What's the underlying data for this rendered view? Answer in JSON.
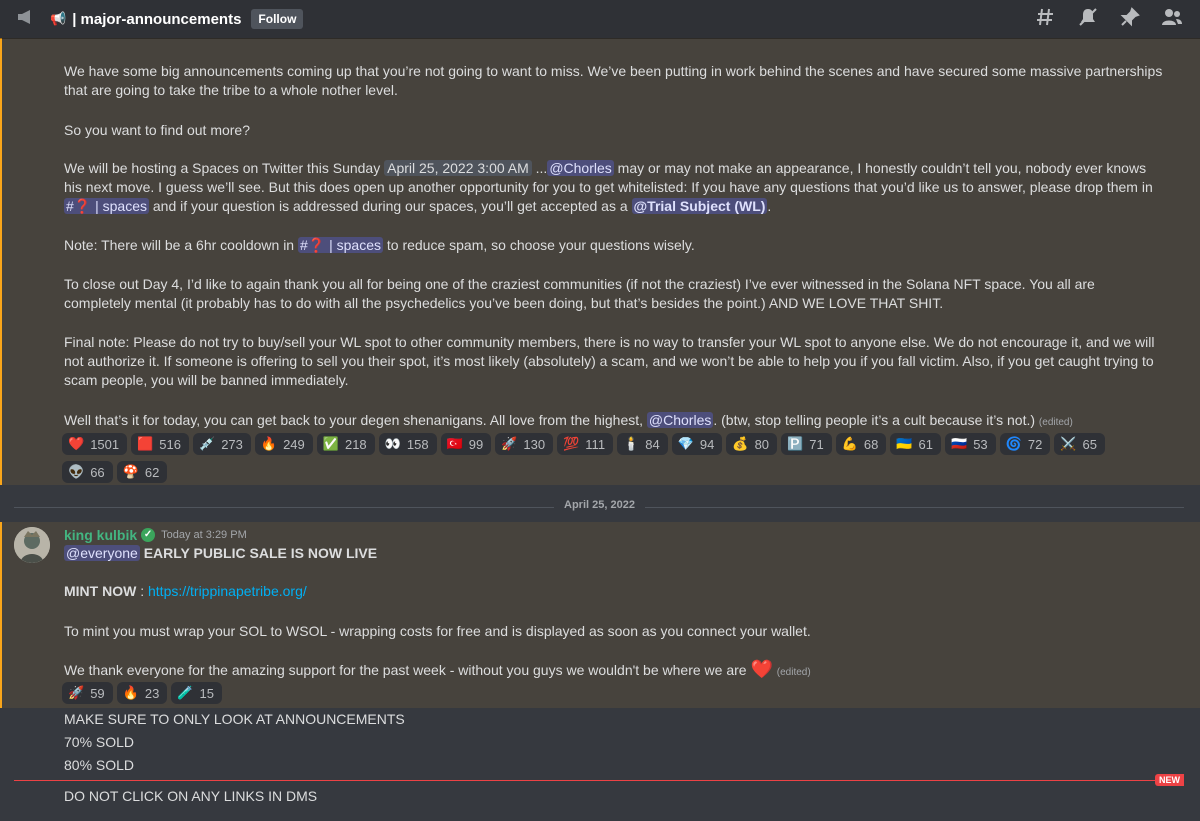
{
  "header": {
    "megaphone_icon": "megaphone-icon",
    "channel_emoji": "📢",
    "channel_name": "| major-announcements",
    "follow_label": "Follow",
    "icons": [
      "threads-icon",
      "mute-icon",
      "pin-icon",
      "members-icon"
    ]
  },
  "msg1": {
    "p1": "We have some big announcements coming up that you’re not going to want to miss. We’ve been putting in work behind the scenes and have secured some massive partnerships that are going to take the tribe to a whole nother level.",
    "p2": "So you want to find out more?",
    "p3": {
      "a": "We will be hosting a Spaces on Twitter this Sunday",
      "timestamp": "April 25, 2022 3:00 AM",
      "b": "...",
      "mention": "@Chorles",
      "c": "may or may not make an appearance, I honestly couldn’t tell you, nobody ever knows his next move. I guess we’ll see. But this does open up another opportunity for you to get whitelisted: If you have any questions that you’d like us to answer, please drop them in",
      "channel": "#❓ | spaces",
      "d": "and if your question is addressed during our spaces, you’ll get accepted as a",
      "role": "@Trial Subject (WL)",
      "e": "."
    },
    "p4": {
      "a": "Note: There will be a 6hr cooldown in",
      "channel": "#❓ | spaces",
      "b": "to reduce spam, so choose your questions wisely."
    },
    "p5": "To close out Day 4, I’d like to again thank you all for being one of the craziest communities (if not the craziest) I’ve ever witnessed in the Solana NFT space. You all are completely mental (it probably has to do with all the psychedelics you’ve been doing, but that’s besides the point.) AND WE LOVE THAT SHIT.",
    "p6": "Final note: Please do not try to buy/sell your WL spot to other community members, there is no way to transfer your WL spot to anyone else. We do not encourage it, and we will not authorize it. If someone is offering to sell you their spot, it’s most likely (absolutely) a scam, and we won’t be able to help you if you fall victim. Also, if you get caught trying to scam people, you will be banned immediately.",
    "p7": {
      "a": "Well that’s it for today, you can get back to your degen shenanigans. All love from the highest,",
      "mention": "@Chorles",
      "b": ". (btw, stop telling people it’s a cult because it’s not.)",
      "edited": "(edited)"
    },
    "reactions": [
      {
        "emoji": "❤️",
        "count": "1501"
      },
      {
        "emoji": "🟥",
        "count": "516"
      },
      {
        "emoji": "💉",
        "count": "273"
      },
      {
        "emoji": "🔥",
        "count": "249"
      },
      {
        "emoji": "✅",
        "count": "218"
      },
      {
        "emoji": "👀",
        "count": "158"
      },
      {
        "emoji": "🇹🇷",
        "count": "99"
      },
      {
        "emoji": "🚀",
        "count": "130"
      },
      {
        "emoji": "💯",
        "count": "111"
      },
      {
        "emoji": "🕯️",
        "count": "84"
      },
      {
        "emoji": "💎",
        "count": "94"
      },
      {
        "emoji": "💰",
        "count": "80"
      },
      {
        "emoji": "🅿️",
        "count": "71"
      },
      {
        "emoji": "💪",
        "count": "68"
      },
      {
        "emoji": "🇺🇦",
        "count": "61"
      },
      {
        "emoji": "🇷🇺",
        "count": "53"
      },
      {
        "emoji": "🌀",
        "count": "72"
      },
      {
        "emoji": "⚔️",
        "count": "65"
      },
      {
        "emoji": "👽",
        "count": "66"
      },
      {
        "emoji": "🍄",
        "count": "62"
      }
    ]
  },
  "divider_date": "April 25, 2022",
  "msg2": {
    "author": "king kulbik",
    "timestamp": "Today at 3:29 PM",
    "mention": "@everyone",
    "headline": "EARLY PUBLIC SALE IS NOW LIVE",
    "mint_label": "MINT NOW",
    "mint_sep": " : ",
    "mint_link": "https://trippinapetribe.org/",
    "line2": "To mint you must wrap your SOL to WSOL - wrapping costs for free and is displayed as soon as you connect your wallet.",
    "line3": "We thank everyone for the amazing support for the past week  - without you guys we wouldn't be where we are",
    "heart": "❤️",
    "edited": "(edited)",
    "reactions": [
      {
        "emoji": "🚀",
        "count": "59"
      },
      {
        "emoji": "🔥",
        "count": "23"
      },
      {
        "emoji": "🧪",
        "count": "15"
      }
    ]
  },
  "followups": [
    "MAKE SURE TO ONLY LOOK AT ANNOUNCEMENTS",
    "70% SOLD",
    "80% SOLD"
  ],
  "new_label": "NEW",
  "last_message": "DO NOT CLICK ON ANY LINKS IN DMS"
}
